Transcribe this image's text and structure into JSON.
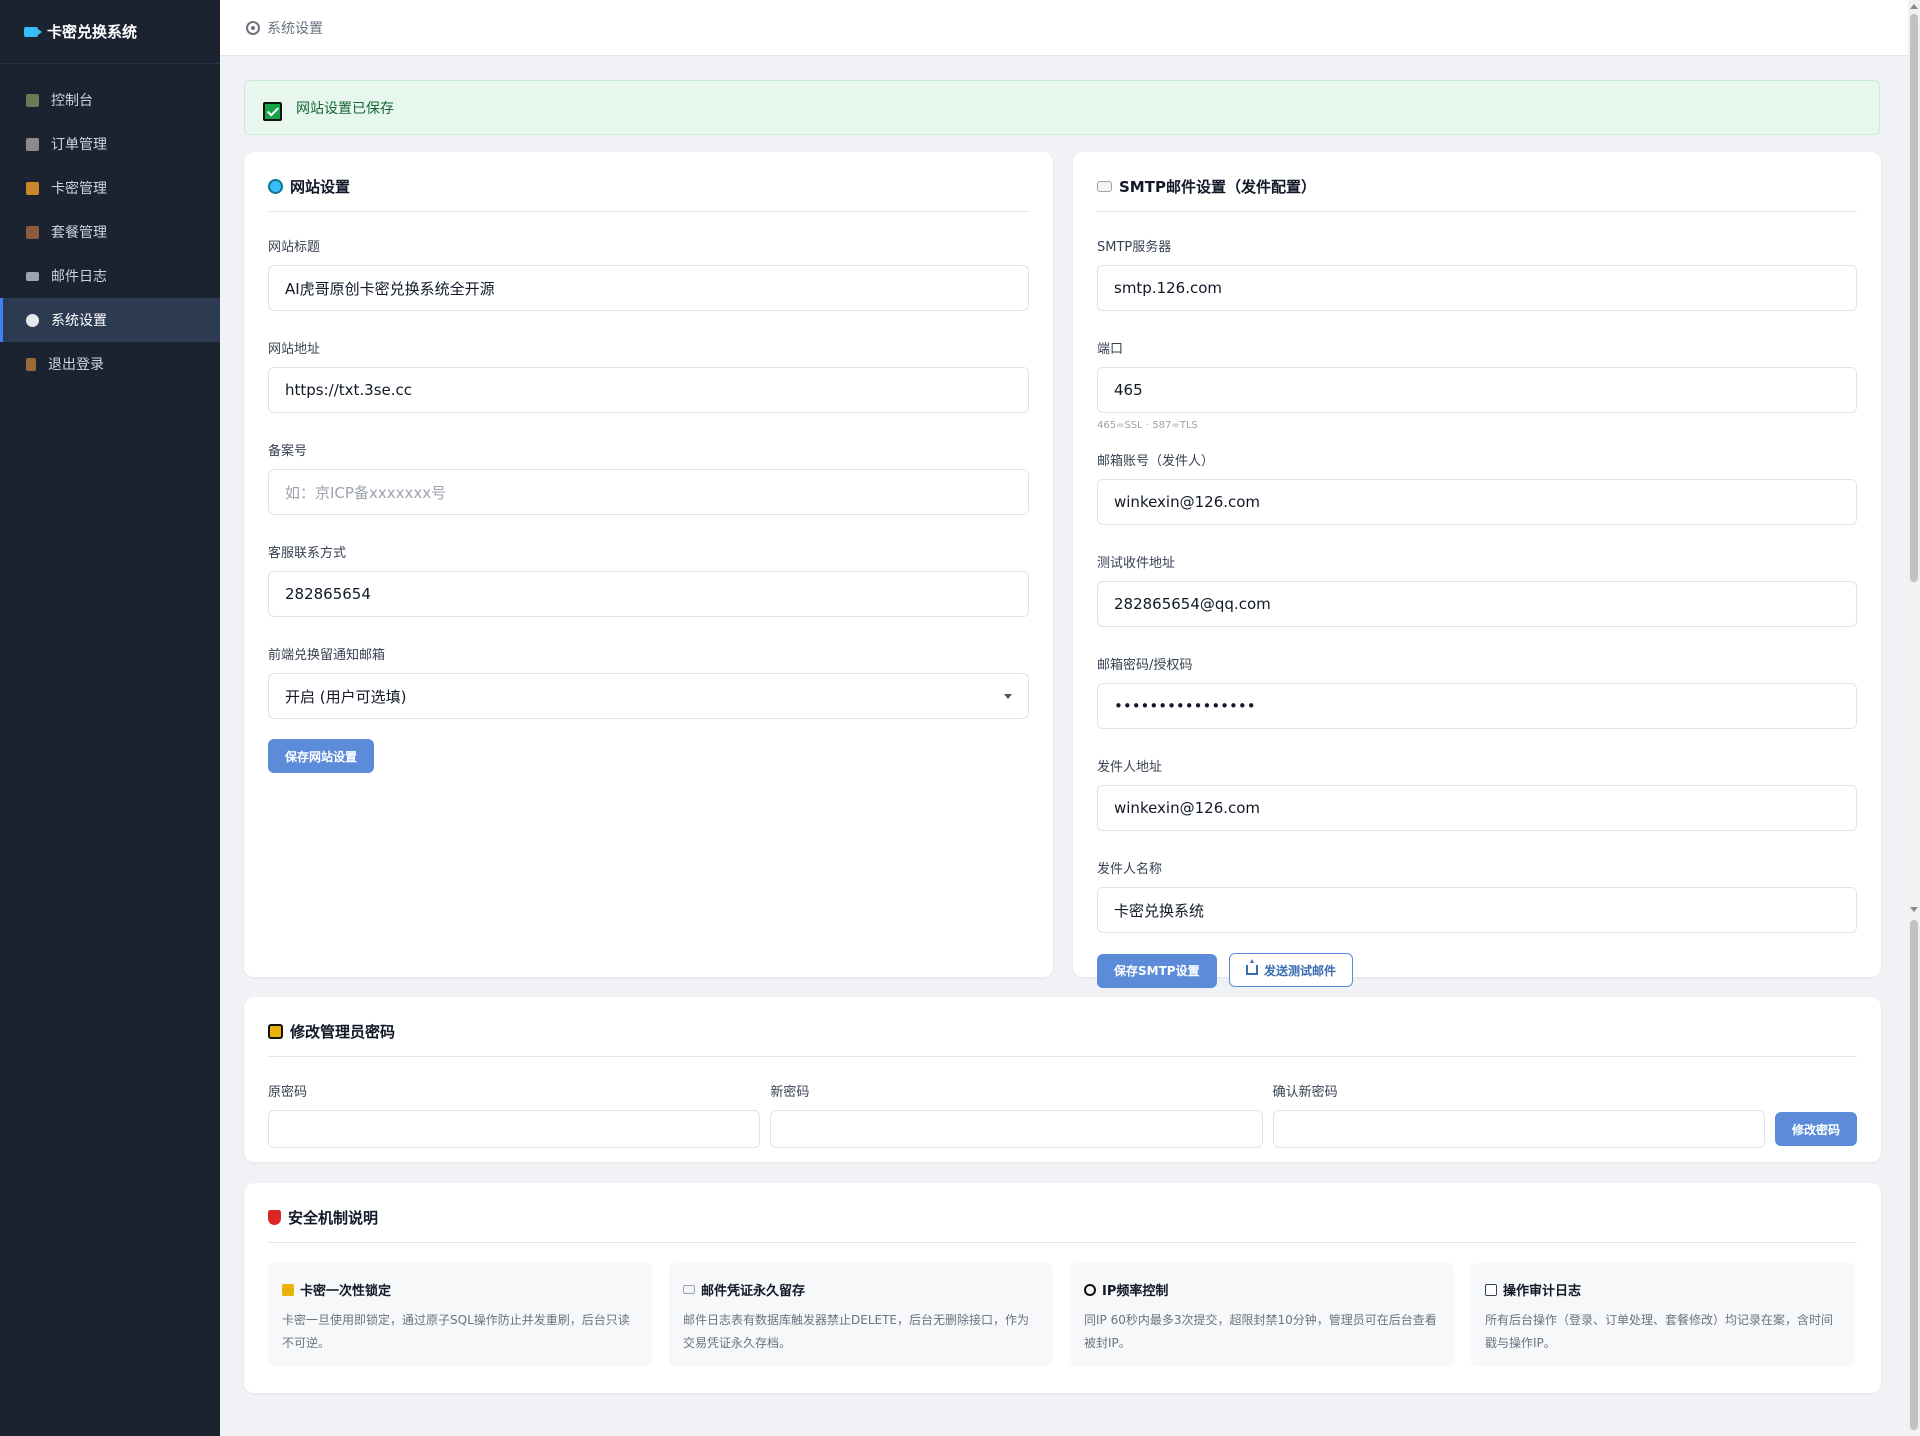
{
  "sidebar": {
    "brand": "卡密兑换系统",
    "items": [
      {
        "label": "控制台",
        "icon": "chart-icon"
      },
      {
        "label": "订单管理",
        "icon": "clipboard-icon"
      },
      {
        "label": "卡密管理",
        "icon": "key-icon"
      },
      {
        "label": "套餐管理",
        "icon": "package-icon"
      },
      {
        "label": "邮件日志",
        "icon": "mail-icon"
      },
      {
        "label": "系统设置",
        "icon": "gear-icon",
        "active": true
      },
      {
        "label": "退出登录",
        "icon": "door-icon"
      }
    ]
  },
  "topbar": {
    "breadcrumb": "系统设置"
  },
  "alert": {
    "text": "网站设置已保存"
  },
  "site": {
    "title": "网站设置",
    "site_title_label": "网站标题",
    "site_title_value": "AI虎哥原创卡密兑换系统全开源",
    "site_url_label": "网站地址",
    "site_url_value": "https://txt.3se.cc",
    "icp_label": "备案号",
    "icp_placeholder": "如：京ICP备xxxxxxx号",
    "contact_label": "客服联系方式",
    "contact_value": "282865654",
    "notify_label": "前端兑换留通知邮箱",
    "notify_value": "开启 (用户可选填)",
    "save_button": "保存网站设置"
  },
  "smtp": {
    "title": "SMTP邮件设置（发件配置）",
    "server_label": "SMTP服务器",
    "server_value": "smtp.126.com",
    "port_label": "端口",
    "port_value": "465",
    "port_hint": "465=SSL · 587=TLS",
    "account_label": "邮箱账号（发件人）",
    "account_value": "winkexin@126.com",
    "test_label": "测试收件地址",
    "test_value": "282865654@qq.com",
    "password_label": "邮箱密码/授权码",
    "password_value": "••••••••••••••••",
    "from_addr_label": "发件人地址",
    "from_addr_value": "winkexin@126.com",
    "from_name_label": "发件人名称",
    "from_name_value": "卡密兑换系统",
    "save_button": "保存SMTP设置",
    "test_button": "发送测试邮件"
  },
  "password": {
    "title": "修改管理员密码",
    "old_label": "原密码",
    "new_label": "新密码",
    "confirm_label": "确认新密码",
    "submit_button": "修改密码"
  },
  "security": {
    "title": "安全机制说明",
    "items": [
      {
        "title": "卡密一次性锁定",
        "desc": "卡密一旦使用即锁定，通过原子SQL操作防止并发重刷，后台只读不可逆。"
      },
      {
        "title": "邮件凭证永久留存",
        "desc": "邮件日志表有数据库触发器禁止DELETE，后台无删除接口，作为交易凭证永久存档。"
      },
      {
        "title": "IP频率控制",
        "desc": "同IP 60秒内最多3次提交，超限封禁10分钟，管理员可在后台查看被封IP。"
      },
      {
        "title": "操作审计日志",
        "desc": "所有后台操作（登录、订单处理、套餐修改）均记录在案，含时间戳与操作IP。"
      }
    ]
  },
  "colors": {
    "sidebar_bg": "#1b2230",
    "accent": "#5b8bd9",
    "success": "#16a34a"
  }
}
